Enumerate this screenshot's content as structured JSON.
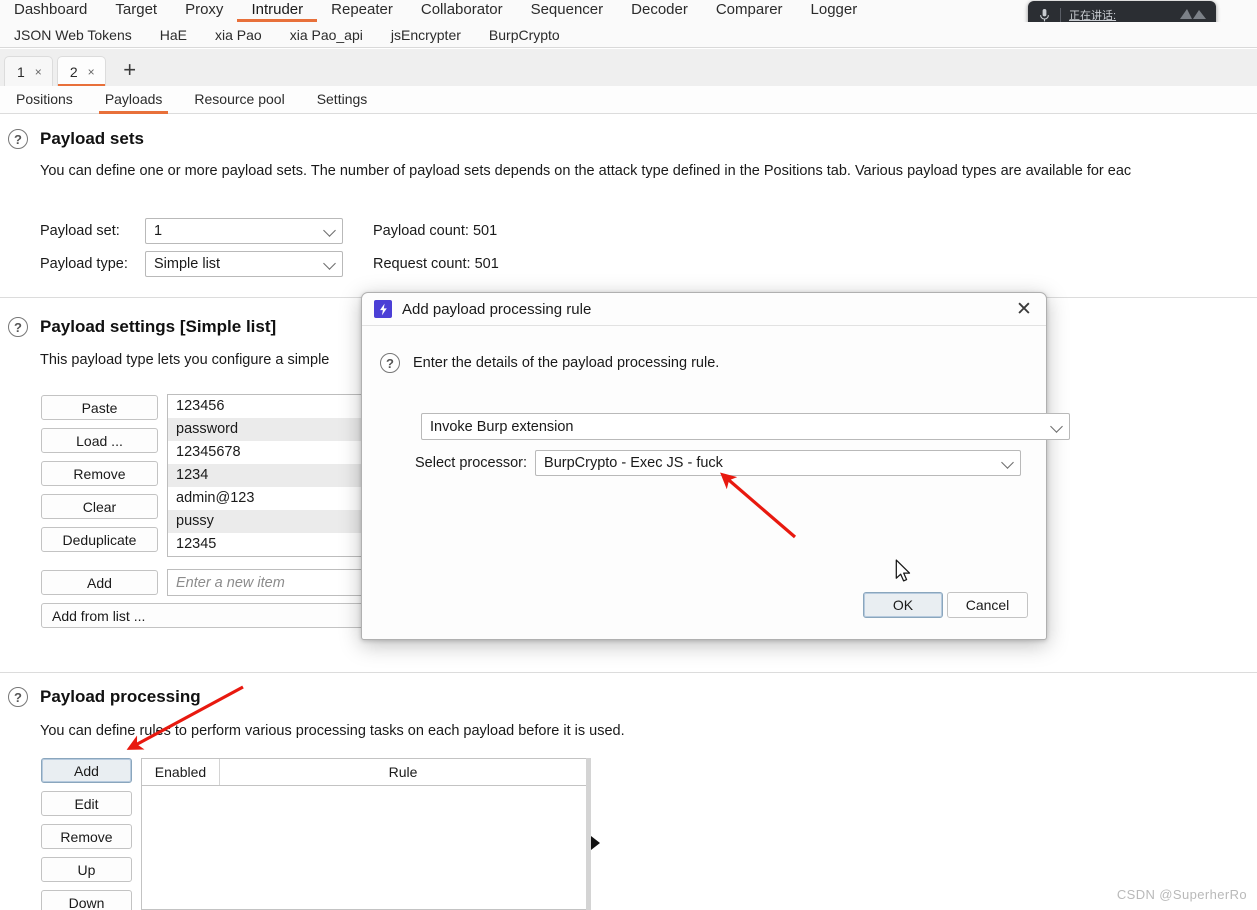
{
  "main_tabs": [
    {
      "label": "Dashboard",
      "active": false
    },
    {
      "label": "Target",
      "active": false
    },
    {
      "label": "Proxy",
      "active": false
    },
    {
      "label": "Intruder",
      "active": true
    },
    {
      "label": "Repeater",
      "active": false
    },
    {
      "label": "Collaborator",
      "active": false
    },
    {
      "label": "Sequencer",
      "active": false
    },
    {
      "label": "Decoder",
      "active": false
    },
    {
      "label": "Comparer",
      "active": false
    },
    {
      "label": "Logger",
      "active": false
    }
  ],
  "extension_tabs": [
    {
      "label": "JSON Web Tokens"
    },
    {
      "label": "HaE"
    },
    {
      "label": "xia Pao"
    },
    {
      "label": "xia Pao_api"
    },
    {
      "label": "jsEncrypter"
    },
    {
      "label": "BurpCrypto"
    }
  ],
  "speech_widget": {
    "text": "正在讲话:",
    "mic_icon": "microphone-icon",
    "wave_icon": "waveform-icon"
  },
  "attack_tabs": [
    {
      "label": "1",
      "close": "×",
      "active": false
    },
    {
      "label": "2",
      "close": "×",
      "active": true
    }
  ],
  "new_tab_label": "+",
  "sub_tabs": [
    {
      "label": "Positions",
      "active": false
    },
    {
      "label": "Payloads",
      "active": true
    },
    {
      "label": "Resource pool",
      "active": false
    },
    {
      "label": "Settings",
      "active": false
    }
  ],
  "payload_sets": {
    "title": "Payload sets",
    "description": "You can define one or more payload sets. The number of payload sets depends on the attack type defined in the Positions tab. Various payload types are available for eac",
    "payload_set_label": "Payload set:",
    "payload_set_value": "1",
    "payload_type_label": "Payload type:",
    "payload_type_value": "Simple list",
    "payload_count": "Payload count: 501",
    "request_count": "Request count: 501"
  },
  "payload_settings": {
    "title": "Payload settings [Simple list]",
    "description": "This payload type lets you configure a simple",
    "buttons": [
      {
        "label": "Paste"
      },
      {
        "label": "Load ..."
      },
      {
        "label": "Remove"
      },
      {
        "label": "Clear"
      },
      {
        "label": "Deduplicate"
      },
      {
        "label": "Add"
      }
    ],
    "add_from_list_label": "Add from list ...",
    "new_item_placeholder": "Enter a new item",
    "items": [
      "123456",
      "password",
      "12345678",
      "1234",
      "admin@123",
      "pussy",
      "12345"
    ]
  },
  "payload_processing": {
    "title": "Payload processing",
    "description": "You can define rules to perform various processing tasks on each payload before it is used.",
    "buttons": [
      {
        "label": "Add",
        "focused": true
      },
      {
        "label": "Edit",
        "focused": false
      },
      {
        "label": "Remove",
        "focused": false
      },
      {
        "label": "Up",
        "focused": false
      },
      {
        "label": "Down",
        "focused": false
      }
    ],
    "table_headers": [
      "Enabled",
      "Rule"
    ],
    "table_rows": []
  },
  "dialog": {
    "title": "Add payload processing rule",
    "icon": "burp-lightning-icon",
    "close_icon": "close-icon",
    "instruction": "Enter the details of the payload processing rule.",
    "rule_type_value": "Invoke Burp extension",
    "processor_label": "Select processor:",
    "processor_value": "BurpCrypto - Exec JS - fuck",
    "ok_label": "OK",
    "cancel_label": "Cancel"
  },
  "annotations": {
    "arrow_color": "#e8190f",
    "arrow_processor": "arrow-pointing-to-processor-dropdown",
    "arrow_add": "arrow-pointing-to-add-button"
  },
  "watermark": "CSDN @SuperherRo",
  "colors": {
    "accent": "#e8703a",
    "dialog_icon_bg": "#4b3fd6",
    "arrow_red": "#e8190f"
  }
}
